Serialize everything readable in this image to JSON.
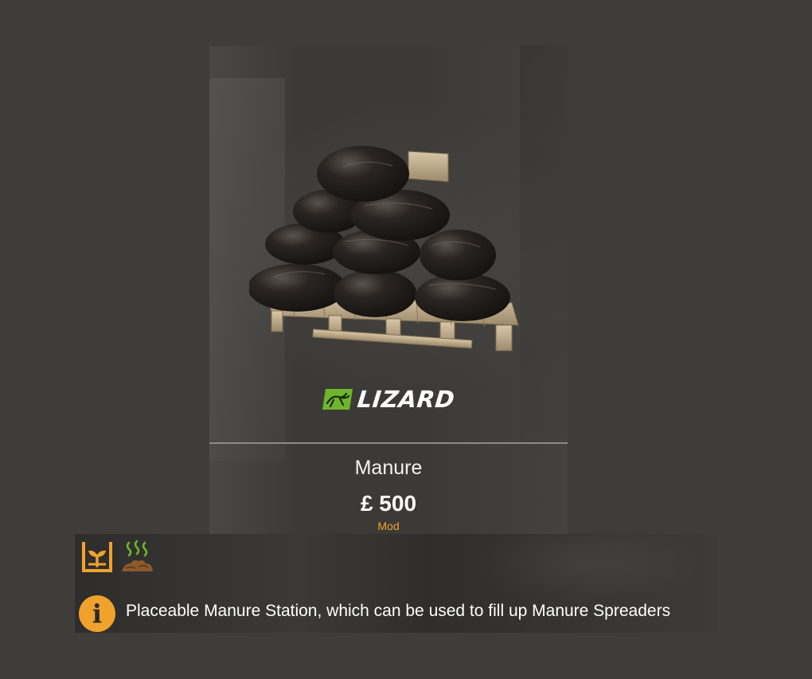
{
  "product": {
    "brand": "LIZARD",
    "name": "Manure",
    "price": "£ 500",
    "source": "Mod"
  },
  "info": {
    "description": "Placeable Manure Station, which can be used to fill up Manure Spreaders",
    "category_icons": [
      "fertilizer-storage-icon",
      "manure-icon"
    ]
  },
  "colors": {
    "accent": "#f0a22c",
    "brand_green": "#6fb52c",
    "background": "#3f3d3a"
  }
}
